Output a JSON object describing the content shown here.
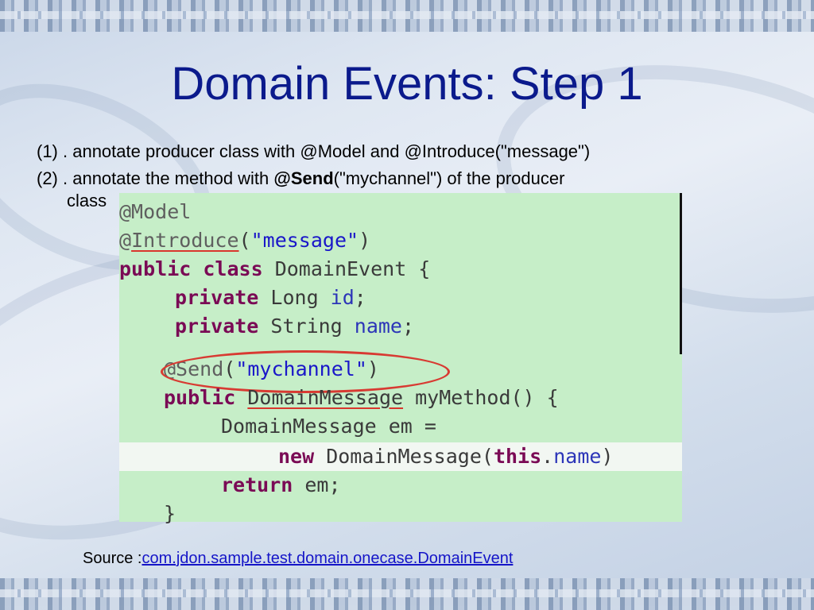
{
  "slide": {
    "title": "Domain Events: Step 1",
    "bullets": [
      {
        "text": "(1) .  annotate producer class with @Model and @Introduce(\"message\")"
      },
      {
        "before": "(2) .  annotate the method with ",
        "bold": "@Send",
        "after": "(\"mychannel\") of the producer",
        "continuation": "class"
      }
    ],
    "code": {
      "lines": [
        {
          "ann": "@Model"
        },
        {
          "ann_at": "@",
          "ann_name": "Introduce",
          "paren_open": "(",
          "str": "\"message\"",
          "paren_close": ")"
        },
        {
          "kw1": "public",
          "kw2": "class",
          "rest": " DomainEvent {"
        },
        {
          "kw": "private",
          "type": " Long ",
          "field": "id",
          "end": ";"
        },
        {
          "kw": "private",
          "type": " String ",
          "field": "name",
          "end": ";"
        },
        {
          "ann": "@Send",
          "paren_open": "(",
          "str": "\"mychannel\"",
          "paren_close": ")"
        },
        {
          "kw": "public",
          "type": "DomainMessage",
          "rest": " myMethod() {"
        },
        {
          "text": "DomainMessage em ="
        },
        {
          "kw": "new",
          "mid": " DomainMessage(",
          "kw2": "this",
          "dot": ".",
          "field": "name",
          "end": ")"
        },
        {
          "kw": "return",
          "rest": " em;"
        },
        {
          "text": "}"
        }
      ]
    },
    "source": {
      "label": "Source :",
      "link": "com.jdon.sample.test.domain.onecase.DomainEvent"
    }
  }
}
